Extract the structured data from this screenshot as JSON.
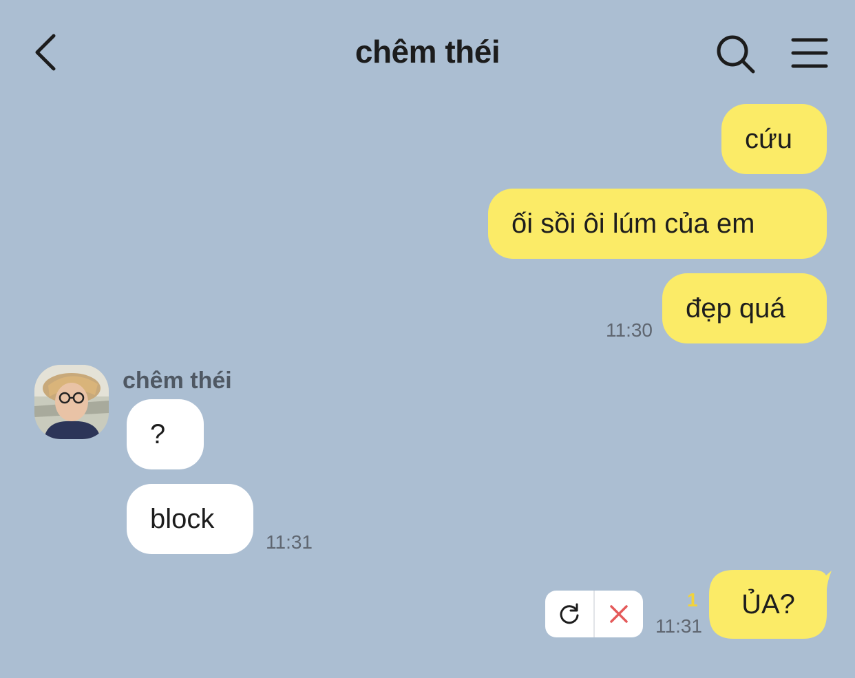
{
  "header": {
    "title": "chêm théi",
    "back_icon": "chevron-left-icon",
    "search_icon": "search-icon",
    "menu_icon": "hamburger-menu-icon"
  },
  "messages": [
    {
      "direction": "outgoing",
      "text": "cứu"
    },
    {
      "direction": "outgoing",
      "text": "ối sồi ôi lúm của em"
    },
    {
      "direction": "outgoing",
      "text": "đẹp quá",
      "time": "11:30"
    },
    {
      "direction": "incoming",
      "sender": "chêm théi",
      "text": "?"
    },
    {
      "direction": "incoming",
      "text": "block",
      "time": "11:31"
    },
    {
      "direction": "outgoing",
      "text": "ỦA?",
      "time": "11:31",
      "unread_count": "1",
      "status": "failed"
    }
  ],
  "failed_actions": {
    "retry_icon": "retry-icon",
    "delete_icon": "close-x-icon"
  },
  "colors": {
    "background": "#abbed2",
    "outgoing_bubble": "#fbeb67",
    "incoming_bubble": "#ffffff",
    "unread": "#f2d33a",
    "delete": "#e45a5a"
  }
}
